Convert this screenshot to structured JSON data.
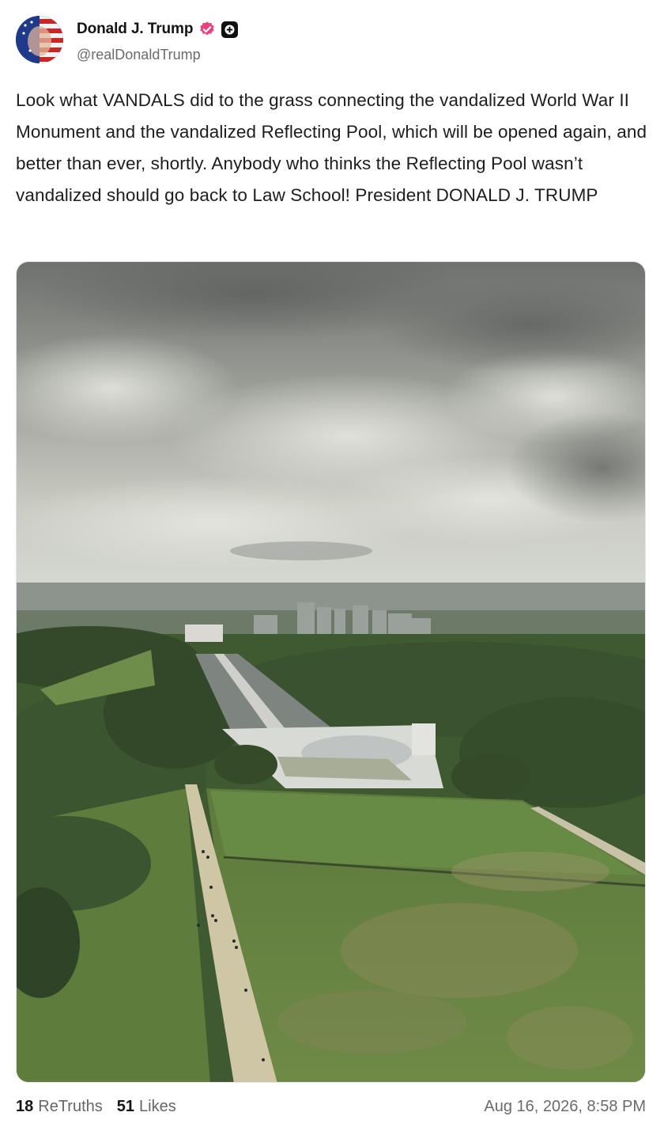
{
  "author": {
    "name": "Donald J. Trump",
    "handle": "@realDonaldTrump",
    "verified_color": "#e9427f"
  },
  "post": {
    "text": "Look what VANDALS did to the grass connecting the vandalized World War II Monument and the vandalized Reflecting Pool, which will be opened again, and better than ever, shortly. Anybody who thinks the Reflecting Pool wasn’t vandalized should go back to Law School! President DONALD J. TRUMP"
  },
  "stats": {
    "retruths_count": "18",
    "retruths_label": "ReTruths",
    "likes_count": "51",
    "likes_label": "Likes"
  },
  "timestamp": "Aug 16, 2026, 8:58 PM",
  "icons": {
    "verified": "verified-badge-icon",
    "plus": "plus-badge-icon"
  }
}
